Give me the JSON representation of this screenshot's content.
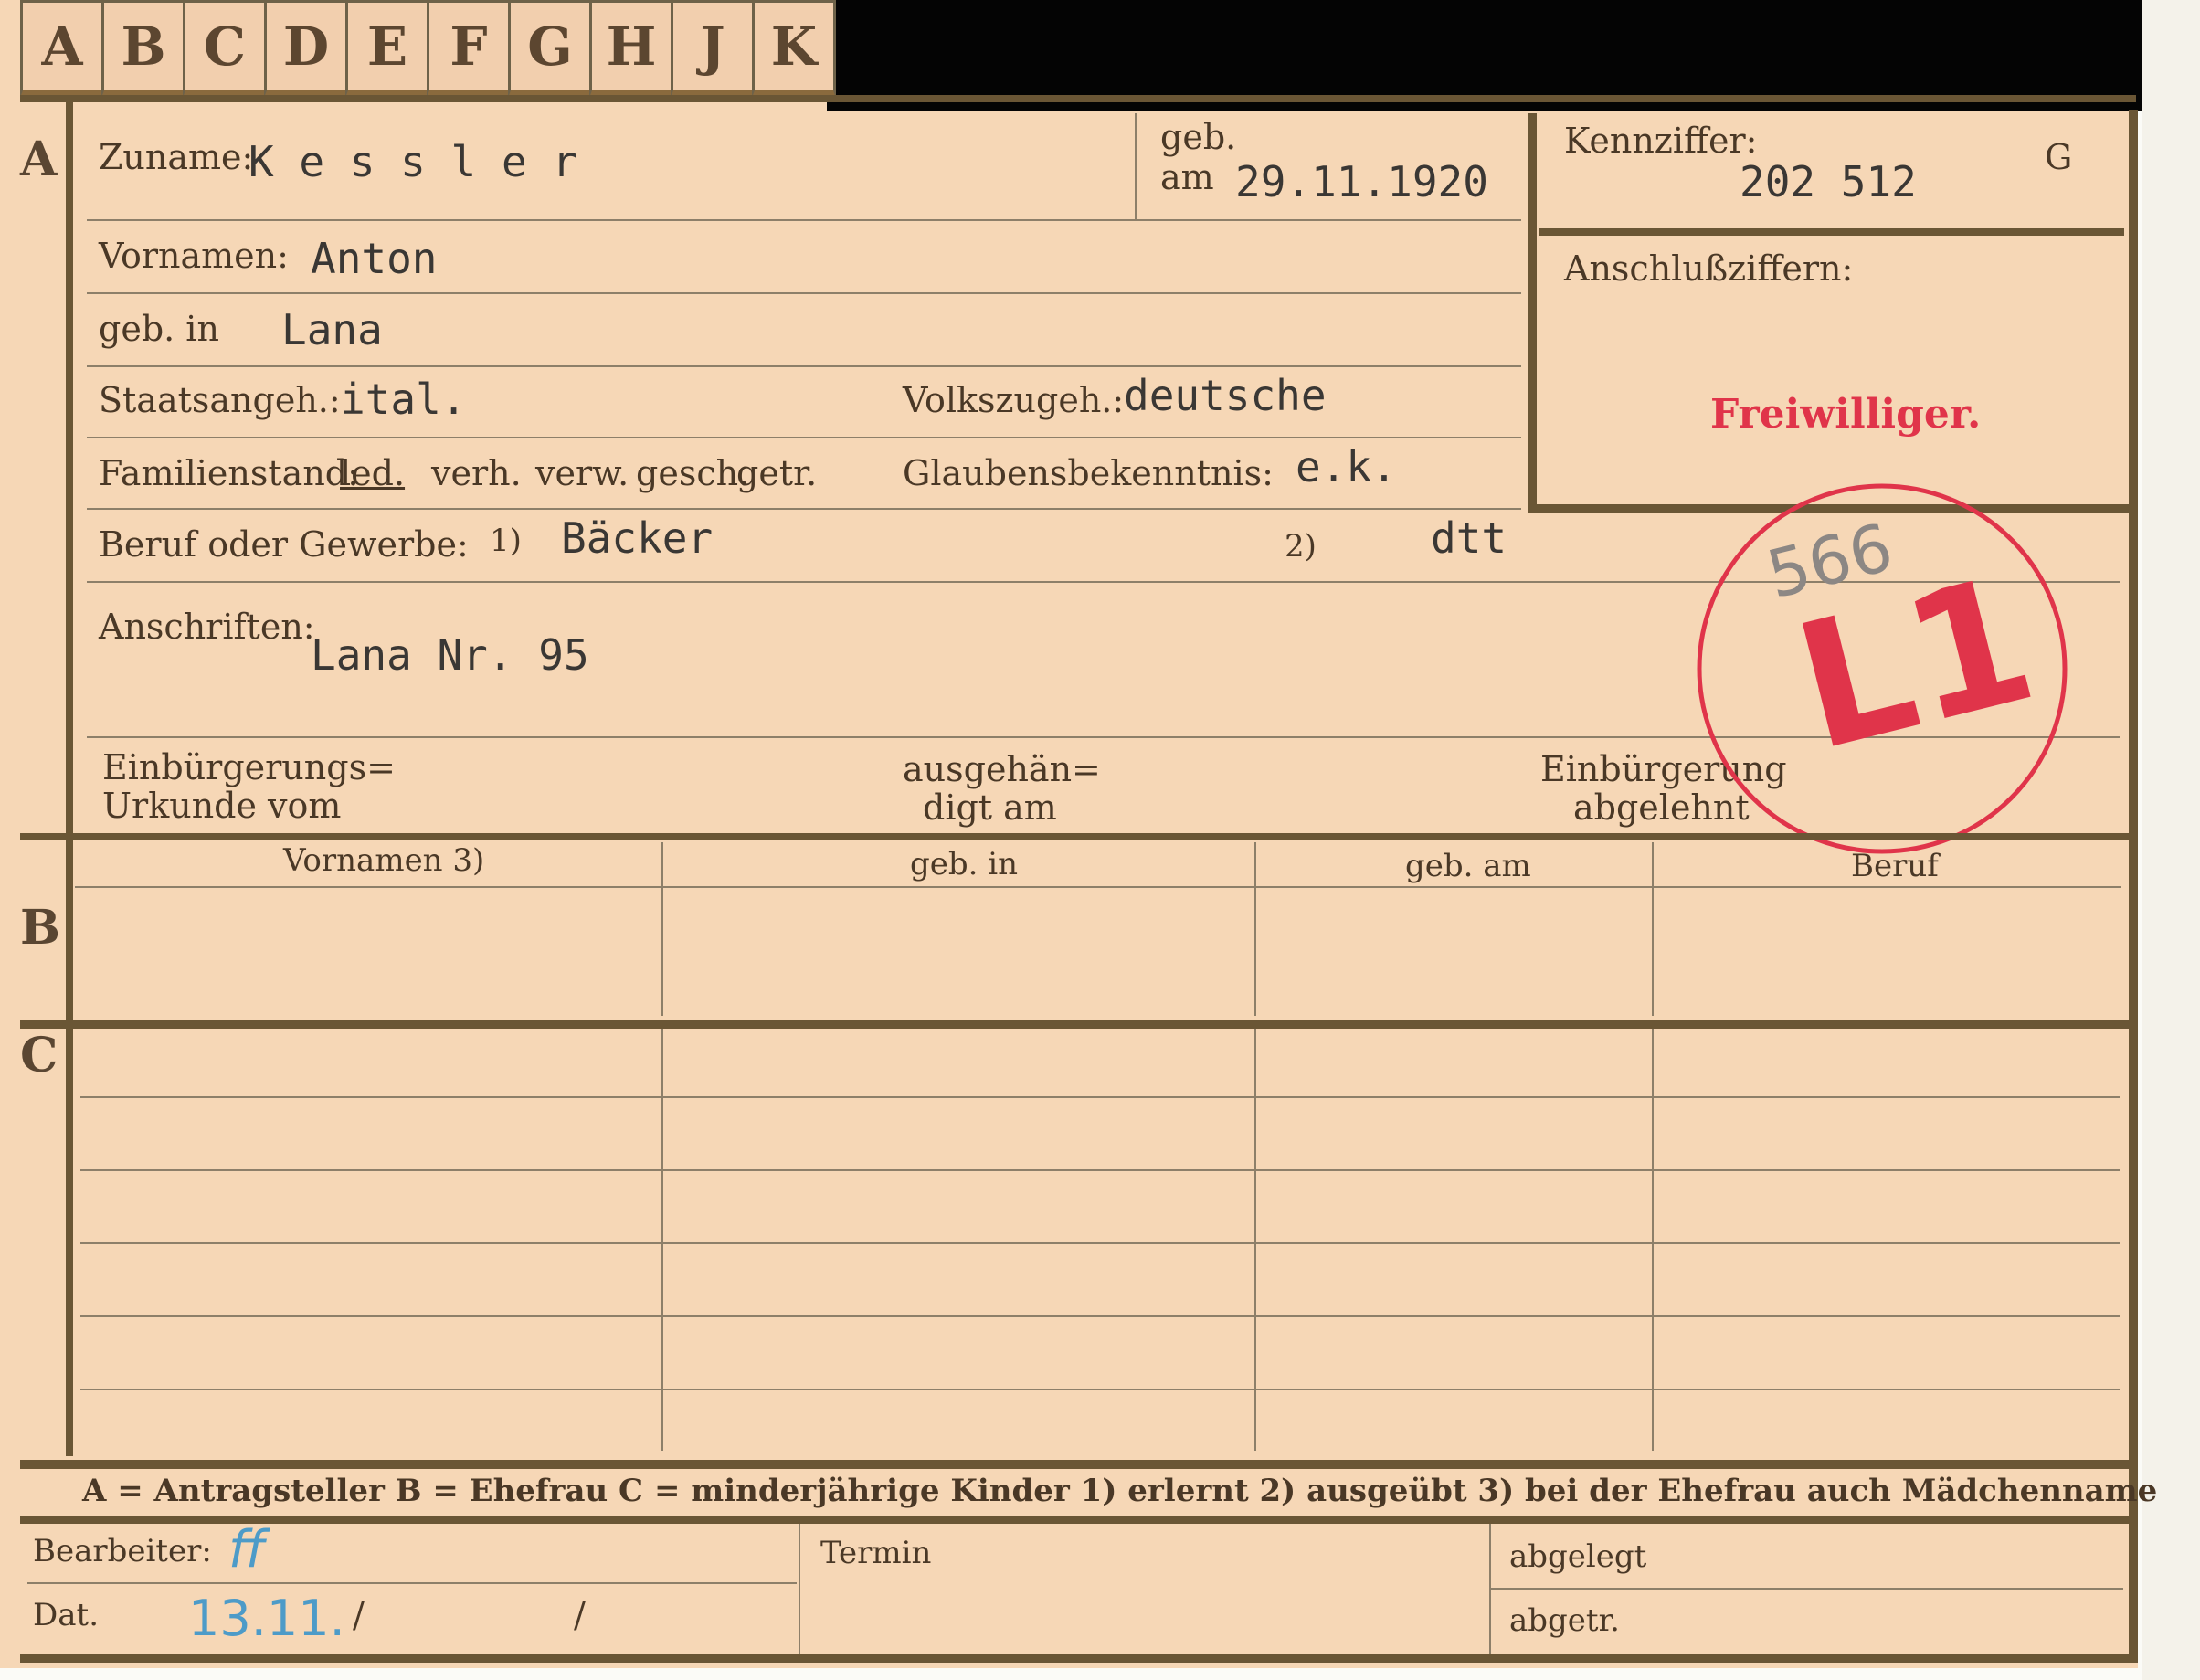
{
  "tabs": [
    "A",
    "B",
    "C",
    "D",
    "E",
    "F",
    "G",
    "H",
    "J",
    "K"
  ],
  "section_letters": {
    "a": "A",
    "b": "B",
    "c": "C"
  },
  "section_a": {
    "zuname_label": "Zuname:",
    "zuname_value": "K e s s l e r",
    "geb_label": "geb.",
    "am_label": "am",
    "geb_am_value": "29.11.1920",
    "vornamen_label": "Vornamen:",
    "vornamen_value": "Anton",
    "geb_in_label": "geb. in",
    "geb_in_value": "Lana",
    "staats_label": "Staatsangeh.:",
    "staats_value": "ital.",
    "volks_label": "Volkszugeh.:",
    "volks_value": "deutsche",
    "familienstand_label": "Familienstand:",
    "familienstand_options": [
      "led.",
      "verh.",
      "verw.",
      "gesch.",
      "getr."
    ],
    "glaubens_label": "Glaubensbekenntnis:",
    "glaubens_value": "e.k.",
    "beruf_label": "Beruf oder Gewerbe:",
    "beruf_note1": "1)",
    "beruf_value1": "Bäcker",
    "beruf_note2": "2)",
    "beruf_value2": "dtt",
    "anschriften_label": "Anschriften:",
    "anschriften_value": "Lana Nr. 95",
    "einb_line1": "Einbürgerungs=",
    "einb_line2": "Urkunde vom",
    "ausg_line1": "ausgehän=",
    "ausg_line2": "digt am",
    "abgel_line1": "Einbürgerung",
    "abgel_line2": "abgelehnt"
  },
  "kennziffer": {
    "label": "Kennziffer:",
    "value": "202 512",
    "suffix": "G",
    "anschluss_label": "Anschlußziffern:",
    "stamp_text": "Freiwilliger."
  },
  "circle_stamp": {
    "handwritten": "566",
    "code": "L1"
  },
  "table_headers": [
    "Vornamen 3)",
    "geb. in",
    "geb. am",
    "Beruf"
  ],
  "legend": "A = Antragsteller   B = Ehefrau   C = minderjährige Kinder   1) erlernt   2) ausgeübt   3) bei der Ehefrau auch Mädchenname",
  "footer": {
    "bearbeiter_label": "Bearbeiter:",
    "bearbeiter_value": "ff",
    "dat_label": "Dat.",
    "dat_value": "13.11.",
    "dat_sep1": "/",
    "dat_sep2": "/",
    "termin_label": "Termin",
    "abgelegt_label": "abgelegt",
    "abgetr_label": "abgetr."
  },
  "colors": {
    "card": "#f6d7b6",
    "rule": "#6a5635",
    "stamp_red": "#e0344a",
    "ink_blue": "#4d9bc8"
  }
}
